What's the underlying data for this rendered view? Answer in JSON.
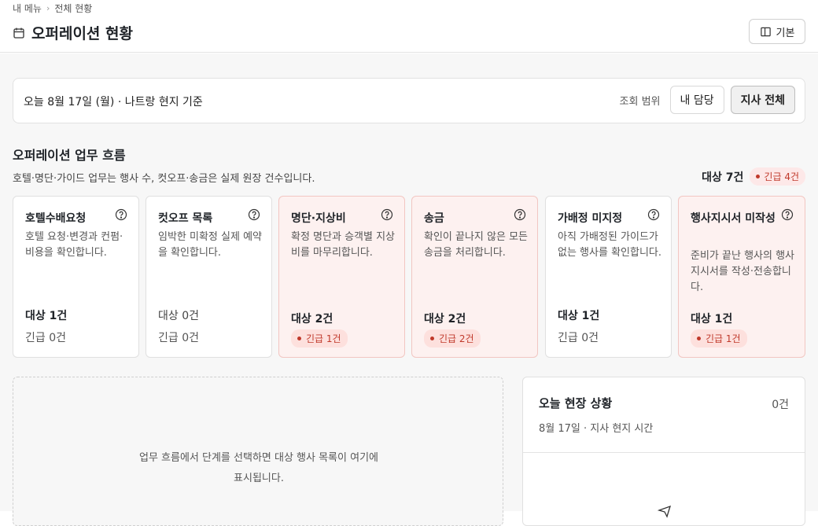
{
  "breadcrumb": {
    "parent": "내 메뉴",
    "current": "전체 현황"
  },
  "page": {
    "title": "오퍼레이션 현황",
    "view_button": "기본"
  },
  "scope": {
    "date_text": "오늘 8월 17일 (월) · 나트랑 현지 기준",
    "label": "조회 범위",
    "options": [
      "내 담당",
      "지사 전체"
    ],
    "selected": "지사 전체"
  },
  "flow": {
    "title": "오퍼레이션 업무 흐름",
    "description": "호텔·명단·가이드 업무는 행사 수, 컷오프·송금은 실제 원장 건수입니다.",
    "total": "대상 7건",
    "urgent_total": "긴급 4건",
    "cards": [
      {
        "title": "호텔수배요청",
        "description": "호텔 요청·변경과 컨펌·비용을 확인합니다.",
        "target": "대상 1건",
        "urgent": "긴급 0건",
        "urgent_count": 0
      },
      {
        "title": "컷오프 목록",
        "description": "임박한 미확정 실제 예약을 확인합니다.",
        "target": "대상 0건",
        "urgent": "긴급 0건",
        "urgent_count": 0
      },
      {
        "title": "명단·지상비",
        "description": "확정 명단과 승객별 지상비를 마무리합니다.",
        "target": "대상 2건",
        "urgent": "긴급 1건",
        "urgent_count": 1
      },
      {
        "title": "송금",
        "description": "확인이 끝나지 않은 모든 송금을 처리합니다.",
        "target": "대상 2건",
        "urgent": "긴급 2건",
        "urgent_count": 2
      },
      {
        "title": "가배정 미지정",
        "description": "아직 가배정된 가이드가 없는 행사를 확인합니다.",
        "target": "대상 1건",
        "urgent": "긴급 0건",
        "urgent_count": 0
      },
      {
        "title": "행사지시서 미작성",
        "description": "준비가 끝난 행사의 행사지시서를 작성·전송합니다.",
        "target": "대상 1건",
        "urgent": "긴급 1건",
        "urgent_count": 1
      }
    ]
  },
  "empty_state": {
    "text_line1": "업무 흐름에서 단계를 선택하면 대상 행사 목록이 여기에",
    "text_line2": "표시됩니다."
  },
  "today": {
    "title": "오늘 현장 상황",
    "count": "0건",
    "subtitle": "8월 17일 · 지사 현지 시간"
  },
  "colors": {
    "urgent": "#c0392b",
    "alert_card_bg": "#fdf1f0",
    "page_bg": "#f7f7f7"
  }
}
